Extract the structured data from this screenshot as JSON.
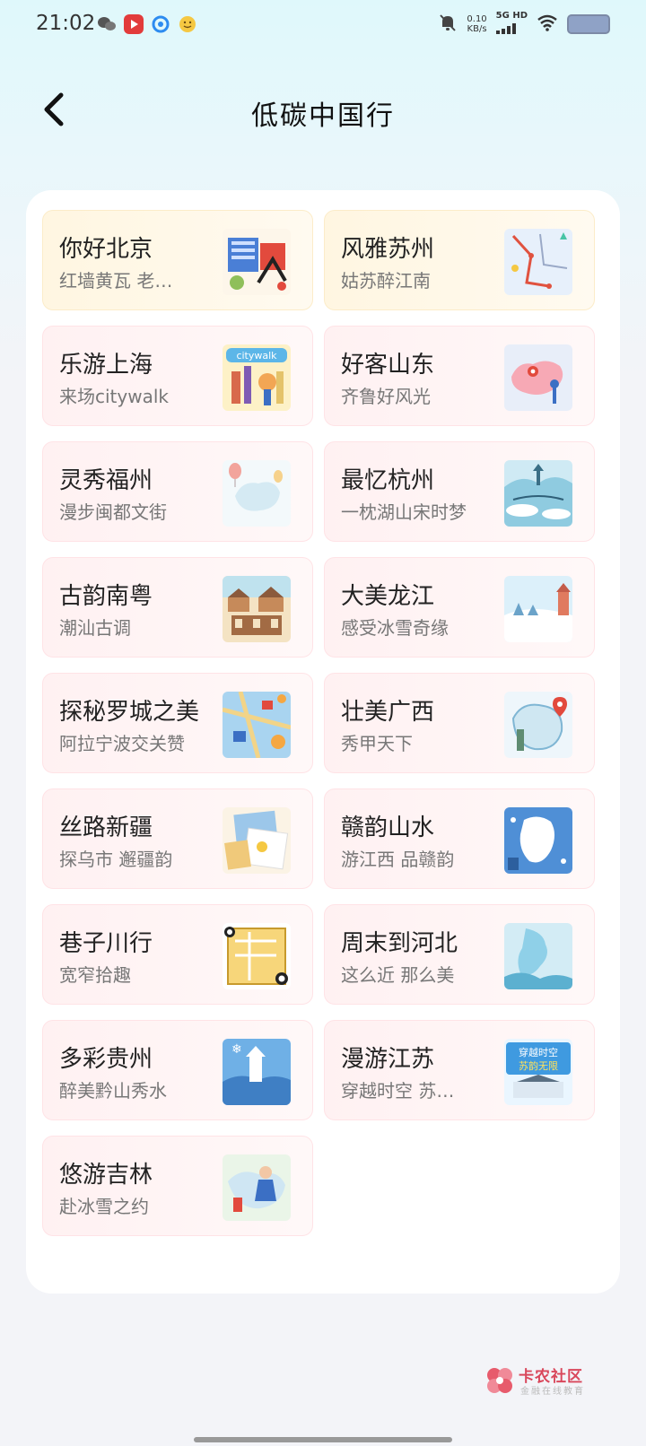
{
  "status_bar": {
    "time": "21:02",
    "apps": [
      "wechat-icon",
      "video-app-icon",
      "browser-icon",
      "emoji-app-icon"
    ],
    "net_speed_value": "0.10",
    "net_speed_unit": "KB/s",
    "network_label_top": "5G HD",
    "icons": [
      "mute-bell-icon",
      "signal-icon",
      "wifi-icon",
      "battery-icon"
    ]
  },
  "header": {
    "title": "低碳中国行",
    "back_icon": "chevron-left-icon"
  },
  "cards": [
    {
      "title": "你好北京",
      "subtitle": "红墙黄瓦 老…",
      "thumb": "beijing"
    },
    {
      "title": "风雅苏州",
      "subtitle": "姑苏醉江南",
      "thumb": "suzhou"
    },
    {
      "title": "乐游上海",
      "subtitle": "来场citywalk",
      "thumb": "shanghai"
    },
    {
      "title": "好客山东",
      "subtitle": "齐鲁好风光",
      "thumb": "shandong"
    },
    {
      "title": "灵秀福州",
      "subtitle": "漫步闽都文街",
      "thumb": "fuzhou"
    },
    {
      "title": "最忆杭州",
      "subtitle": "一枕湖山宋时梦",
      "thumb": "hangzhou"
    },
    {
      "title": "古韵南粤",
      "subtitle": "潮汕古调",
      "thumb": "nanyue"
    },
    {
      "title": "大美龙江",
      "subtitle": "感受冰雪奇缘",
      "thumb": "longjiang"
    },
    {
      "title": "探秘罗城之美",
      "subtitle": "阿拉宁波交关赞",
      "thumb": "ningbo"
    },
    {
      "title": "壮美广西",
      "subtitle": "秀甲天下",
      "thumb": "guangxi"
    },
    {
      "title": "丝路新疆",
      "subtitle": "探乌市 邂疆韵",
      "thumb": "xinjiang"
    },
    {
      "title": "赣韵山水",
      "subtitle": "游江西 品赣韵",
      "thumb": "jiangxi"
    },
    {
      "title": "巷子川行",
      "subtitle": "宽窄拾趣",
      "thumb": "sichuan"
    },
    {
      "title": "周末到河北",
      "subtitle": "这么近 那么美",
      "thumb": "hebei"
    },
    {
      "title": "多彩贵州",
      "subtitle": "醉美黔山秀水",
      "thumb": "guizhou"
    },
    {
      "title": "漫游江苏",
      "subtitle": "穿越时空 苏…",
      "thumb": "jiangsu",
      "thumb_text": "穿越时空 苏韵无限"
    },
    {
      "title": "悠游吉林",
      "subtitle": "赴冰雪之约",
      "thumb": "jilin"
    }
  ],
  "watermark": {
    "name": "卡农社区",
    "sub": "金融在线教育"
  },
  "colors": {
    "card_pink": "#fff1f2",
    "card_gold": "#fff6e1",
    "accent_red": "#d9475b"
  }
}
